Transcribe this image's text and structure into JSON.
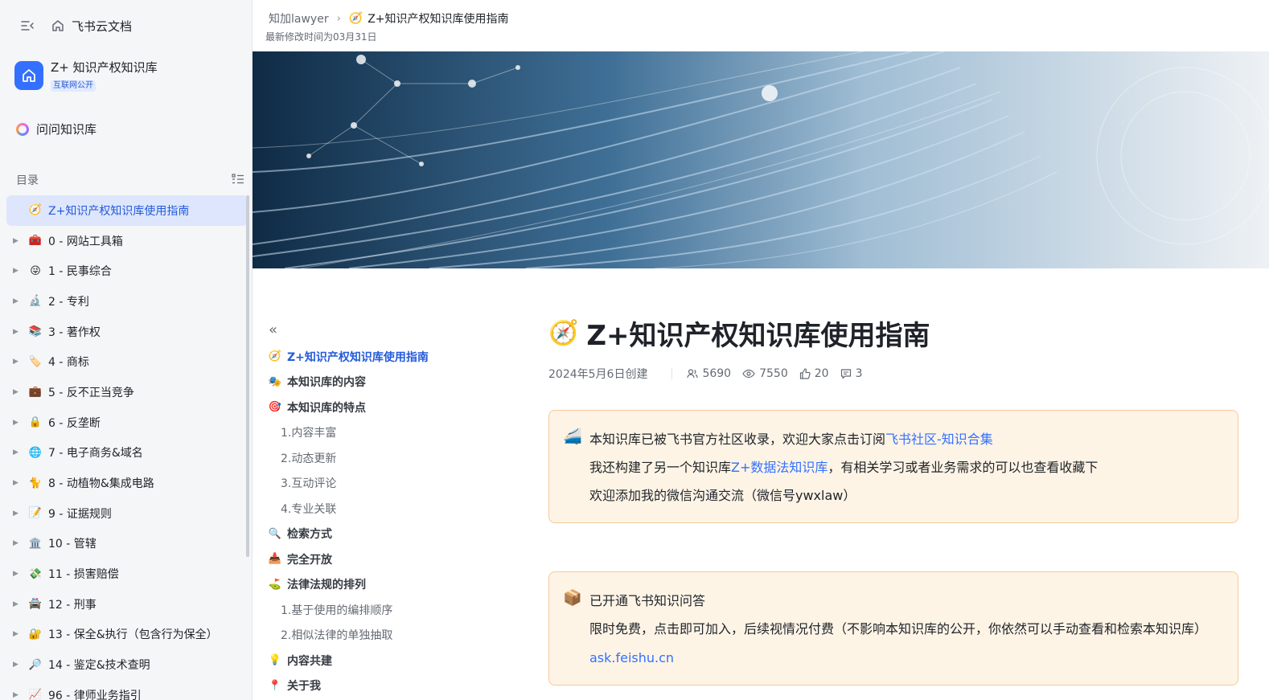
{
  "app": {
    "brand": "飞书云文档",
    "kb_name": "Z+ 知识产权知识库",
    "kb_badge": "互联网公开",
    "ask_label": "问问知识库",
    "toc_title": "目录"
  },
  "nav": [
    {
      "emoji": "🧭",
      "label": "Z+知识产权知识库使用指南",
      "active": true
    },
    {
      "emoji": "🧰",
      "label": "0 - 网站工具箱"
    },
    {
      "emoji": "😜",
      "label": "1 - 民事综合"
    },
    {
      "emoji": "🔬",
      "label": "2 - 专利"
    },
    {
      "emoji": "📚",
      "label": "3 - 著作权"
    },
    {
      "emoji": "🏷️",
      "label": "4 - 商标"
    },
    {
      "emoji": "💼",
      "label": "5 - 反不正当竞争"
    },
    {
      "emoji": "🔒",
      "label": "6 - 反垄断"
    },
    {
      "emoji": "🌐",
      "label": "7 - 电子商务&域名"
    },
    {
      "emoji": "🐈",
      "label": "8 - 动植物&集成电路"
    },
    {
      "emoji": "📝",
      "label": "9 - 证据规则"
    },
    {
      "emoji": "🏛️",
      "label": "10 - 管辖"
    },
    {
      "emoji": "💸",
      "label": "11 - 损害赔偿"
    },
    {
      "emoji": "🚔",
      "label": "12 - 刑事"
    },
    {
      "emoji": "🔐",
      "label": "13 - 保全&执行（包含行为保全）"
    },
    {
      "emoji": "🔎",
      "label": "14 - 鉴定&技术查明"
    },
    {
      "emoji": "📈",
      "label": "96 - 律师业务指引"
    }
  ],
  "breadcrumb": {
    "parent": "知加lawyer",
    "current_emoji": "🧭",
    "current": "Z+知识产权知识库使用指南"
  },
  "modified": "最新修改时间为03月31日",
  "outline": [
    {
      "level": 1,
      "emoji": "🧭",
      "label": "Z+知识产权知识库使用指南",
      "current": true
    },
    {
      "level": 1,
      "emoji": "🎭",
      "label": "本知识库的内容"
    },
    {
      "level": 1,
      "emoji": "🎯",
      "label": "本知识库的特点"
    },
    {
      "level": 2,
      "label": "1.内容丰富"
    },
    {
      "level": 2,
      "label": "2.动态更新"
    },
    {
      "level": 2,
      "label": "3.互动评论"
    },
    {
      "level": 2,
      "label": "4.专业关联"
    },
    {
      "level": 1,
      "emoji": "🔍",
      "label": "检索方式"
    },
    {
      "level": 1,
      "emoji": "📥",
      "label": "完全开放"
    },
    {
      "level": 1,
      "emoji": "⛳",
      "label": "法律法规的排列"
    },
    {
      "level": 2,
      "label": "1.基于使用的编排顺序"
    },
    {
      "level": 2,
      "label": "2.相似法律的单独抽取"
    },
    {
      "level": 1,
      "emoji": "💡",
      "label": "内容共建"
    },
    {
      "level": 1,
      "emoji": "📍",
      "label": "关于我"
    }
  ],
  "doc": {
    "title_emoji": "🧭",
    "title": "Z+知识产权知识库使用指南",
    "created": "2024年5月6日创建",
    "stats": {
      "readers": "5690",
      "views": "7550",
      "likes": "20",
      "comments": "3"
    },
    "callout1": {
      "emoji": "🚄",
      "line1_text": "本知识库已被飞书官方社区收录，欢迎大家点击订阅",
      "line1_link": "飞书社区-知识合集",
      "line2_prefix": "我还构建了另一个知识库",
      "line2_link": "Z+数据法知识库",
      "line2_suffix": "，有相关学习或者业务需求的可以也查看收藏下",
      "line3": "欢迎添加我的微信沟通交流（微信号ywxlaw）"
    },
    "callout2": {
      "emoji": "📦",
      "line1": "已开通飞书知识问答",
      "line2": "限时免费，点击即可加入，后续视情况付费（不影响本知识库的公开，你依然可以手动查看和检索本知识库）",
      "link": "ask.feishu.cn"
    }
  }
}
